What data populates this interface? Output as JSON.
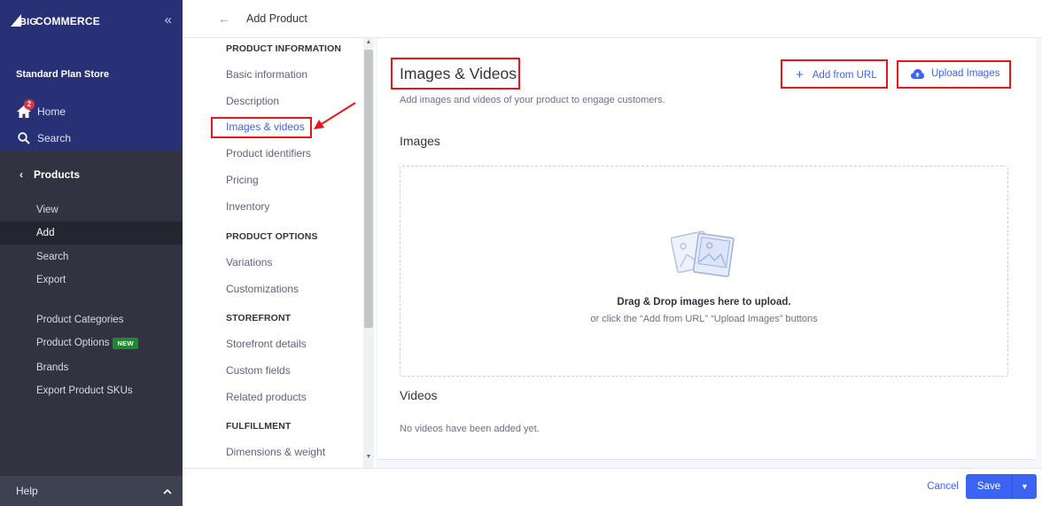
{
  "brand": {
    "name": "COMMERCE",
    "prefix": "BIG"
  },
  "store_name": "Standard Plan Store",
  "sidebar": {
    "home": {
      "label": "Home",
      "badge": "2"
    },
    "search": {
      "label": "Search"
    },
    "products": {
      "label": "Products"
    },
    "product_sub": [
      "View",
      "Add",
      "Search",
      "Export"
    ],
    "product_links": [
      "Product Categories",
      "Product Options",
      "Brands",
      "Export Product SKUs"
    ],
    "new_badge": "NEW",
    "help": "Help"
  },
  "header": {
    "title": "Add Product"
  },
  "section_nav": {
    "product_information": "PRODUCT INFORMATION",
    "basic_information": "Basic information",
    "description": "Description",
    "images_videos": "Images & videos",
    "product_identifiers": "Product identifiers",
    "pricing": "Pricing",
    "inventory": "Inventory",
    "product_options": "PRODUCT OPTIONS",
    "variations": "Variations",
    "customizations": "Customizations",
    "storefront": "STOREFRONT",
    "storefront_details": "Storefront details",
    "custom_fields": "Custom fields",
    "related_products": "Related products",
    "fulfillment": "FULFILLMENT",
    "dimensions_weight": "Dimensions & weight"
  },
  "panel": {
    "title": "Images & Videos",
    "subtitle": "Add images and videos of your product to engage customers.",
    "add_from_url": "Add from URL",
    "upload_images": "Upload Images",
    "images_heading": "Images",
    "drop_main": "Drag & Drop images here to upload.",
    "drop_sub": "or click the “Add from URL” “Upload Images” buttons",
    "videos_heading": "Videos",
    "no_videos": "No videos have been added yet."
  },
  "footer": {
    "cancel": "Cancel",
    "save": "Save"
  },
  "colors": {
    "accent": "#3c64f4",
    "sidebar_top": "#293176",
    "sidebar": "#313440",
    "annotation": "#e8151b",
    "new_badge": "#208831"
  }
}
